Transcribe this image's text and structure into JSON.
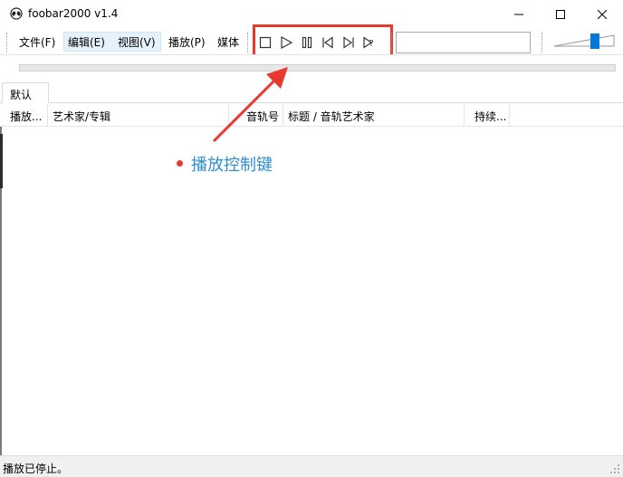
{
  "window": {
    "title": "foobar2000 v1.4",
    "app_icon": "alien-icon"
  },
  "menu": {
    "items": [
      {
        "label": "文件(F)"
      },
      {
        "label": "编辑(E)"
      },
      {
        "label": "视图(V)"
      },
      {
        "label": "播放(P)"
      },
      {
        "label": "媒体"
      }
    ]
  },
  "playback_controls": [
    {
      "name": "stop",
      "icon": "stop-icon"
    },
    {
      "name": "play",
      "icon": "play-icon"
    },
    {
      "name": "pause",
      "icon": "pause-icon"
    },
    {
      "name": "previous",
      "icon": "previous-icon"
    },
    {
      "name": "next",
      "icon": "next-icon"
    },
    {
      "name": "random",
      "icon": "random-icon"
    }
  ],
  "volume": {
    "level_fraction": 0.72
  },
  "seek": {
    "progress_fraction": 0
  },
  "tabs": [
    {
      "label": "默认"
    }
  ],
  "columns": [
    {
      "label": "播放..."
    },
    {
      "label": "艺术家/专辑"
    },
    {
      "label": "音轨号"
    },
    {
      "label": "标题 / 音轨艺术家"
    },
    {
      "label": "持续..."
    }
  ],
  "annotation": {
    "text": "播放控制键",
    "color": "#2f8fd0",
    "accent": "#e8392f"
  },
  "status": {
    "text": "播放已停止。"
  }
}
